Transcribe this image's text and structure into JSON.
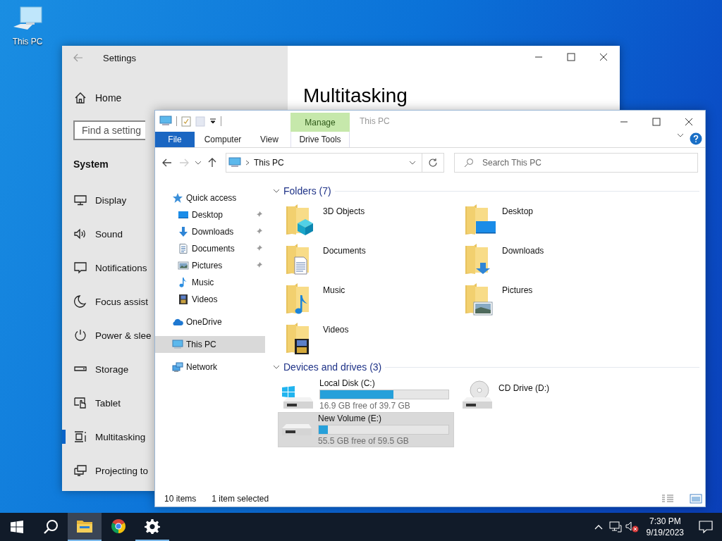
{
  "desktop": {
    "icons": [
      {
        "label": "This PC"
      }
    ]
  },
  "settings": {
    "title": "Settings",
    "home": "Home",
    "search": {
      "placeholder": "Find a setting"
    },
    "section": "System",
    "nav": [
      {
        "label": "Display",
        "selected": false
      },
      {
        "label": "Sound",
        "selected": false
      },
      {
        "label": "Notifications",
        "selected": false
      },
      {
        "label": "Focus assist",
        "selected": false
      },
      {
        "label": "Power & slee",
        "selected": false
      },
      {
        "label": "Storage",
        "selected": false
      },
      {
        "label": "Tablet",
        "selected": false
      },
      {
        "label": "Multitasking",
        "selected": true
      },
      {
        "label": "Projecting to",
        "selected": false
      }
    ],
    "heading": "Multitasking"
  },
  "explorer": {
    "title": "This PC",
    "context_tab": "Manage",
    "ribbon_tabs": [
      {
        "label": "File",
        "kind": "file"
      },
      {
        "label": "Computer",
        "kind": "tab"
      },
      {
        "label": "View",
        "kind": "tab"
      },
      {
        "label": "Drive Tools",
        "kind": "context"
      }
    ],
    "address": {
      "path": "This PC"
    },
    "search": {
      "placeholder": "Search This PC"
    },
    "navigation": [
      {
        "label": "Quick access",
        "selected": false,
        "children": [
          {
            "label": "Desktop",
            "pinned": true,
            "selected": false
          },
          {
            "label": "Downloads",
            "pinned": true,
            "selected": false
          },
          {
            "label": "Documents",
            "pinned": true,
            "selected": false
          },
          {
            "label": "Pictures",
            "pinned": true,
            "selected": false
          },
          {
            "label": "Music",
            "pinned": false,
            "selected": false
          },
          {
            "label": "Videos",
            "pinned": false,
            "selected": false
          }
        ]
      },
      {
        "label": "OneDrive",
        "selected": false
      },
      {
        "label": "This PC",
        "selected": true
      },
      {
        "label": "Network",
        "selected": false
      }
    ],
    "groups": [
      {
        "title": "Folders (7)",
        "expanded": true,
        "kind": "folders",
        "items": [
          {
            "label": "3D Objects"
          },
          {
            "label": "Desktop"
          },
          {
            "label": "Documents"
          },
          {
            "label": "Downloads"
          },
          {
            "label": "Music"
          },
          {
            "label": "Pictures"
          },
          {
            "label": "Videos"
          }
        ]
      },
      {
        "title": "Devices and drives (3)",
        "expanded": true,
        "kind": "drives",
        "items": [
          {
            "kind": "system",
            "label": "Local Disk (C:)",
            "level": 0.57,
            "free": "16.9 GB free of 39.7 GB",
            "selected": false
          },
          {
            "kind": "optical",
            "label": "CD Drive (D:)",
            "selected": false
          },
          {
            "kind": "volume",
            "label": "New Volume (E:)",
            "level": 0.07,
            "free": "55.5 GB free of 59.5 GB",
            "selected": true
          }
        ]
      }
    ],
    "status_bar": {
      "item_count": "10 items",
      "selection": "1 item selected"
    }
  },
  "taskbar": {
    "apps": [
      {
        "selected": true,
        "running": true
      },
      {
        "selected": false,
        "running": false
      },
      {
        "selected": false,
        "running": true
      }
    ],
    "clock": {
      "time": "7:30 PM",
      "date": "9/19/2023"
    }
  }
}
